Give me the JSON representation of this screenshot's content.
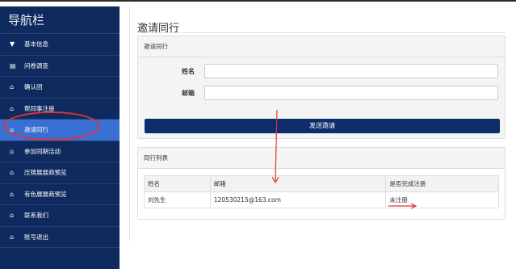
{
  "sidebar": {
    "title": "导航栏",
    "items": [
      {
        "label": "基本信息",
        "icon": "filter-icon"
      },
      {
        "label": "问卷调查",
        "icon": "keyboard-icon"
      },
      {
        "label": "确认团",
        "icon": "home-icon"
      },
      {
        "label": "帮同事注册",
        "icon": "home-icon"
      },
      {
        "label": "邀请同行",
        "icon": "home-icon",
        "active": true
      },
      {
        "label": "参加同期活动",
        "icon": "home-icon"
      },
      {
        "label": "压铸展展商预览",
        "icon": "home-icon"
      },
      {
        "label": "有色展展商预览",
        "icon": "home-icon"
      },
      {
        "label": "联系我们",
        "icon": "home-icon"
      },
      {
        "label": "账号退出",
        "icon": "home-icon"
      }
    ]
  },
  "main": {
    "page_title": "邀请同行",
    "invite_panel": {
      "heading": "邀请同行",
      "name_label": "姓名",
      "name_value": "",
      "email_label": "邮箱",
      "email_value": "",
      "send_button": "发送邀请"
    },
    "list_panel": {
      "heading": "同行列表",
      "columns": [
        "姓名",
        "邮箱",
        "是否完成注册"
      ],
      "rows": [
        [
          "刘先生",
          "120530215@163.com",
          "未注册"
        ]
      ]
    }
  },
  "colors": {
    "sidebar_bg": "#0e2a5e",
    "sidebar_active": "#3a6fd3",
    "button_bg": "#0d2e6b",
    "annotation_red": "#d8343c"
  }
}
